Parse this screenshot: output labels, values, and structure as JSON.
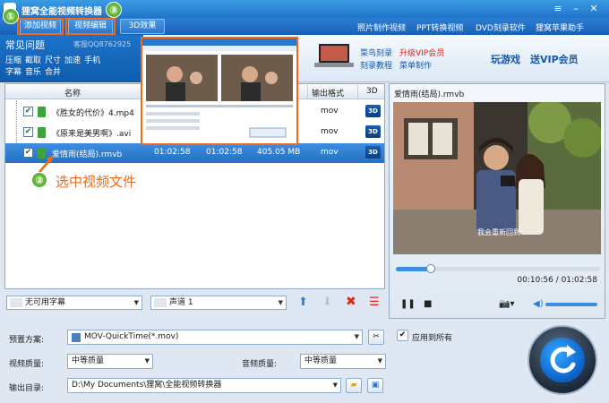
{
  "app": {
    "title": "狸窝全能视频转换器"
  },
  "toolbar": {
    "add_video": "添加视频",
    "edit_video": "视频编辑",
    "effect_3d": "3D效果",
    "links": [
      "照片制作视频",
      "PPT转换视频",
      "DVD刻录软件",
      "狸窝苹果助手"
    ]
  },
  "info": {
    "faq_title": "常见问题",
    "support_id": "客服QQ8762925",
    "faq_row1": [
      "压缩",
      "截取",
      "尺寸",
      "加速",
      "手机"
    ],
    "faq_row2": [
      "字幕",
      "音乐",
      "合并"
    ],
    "promo_1": "菜鸟刻录",
    "promo_vip": "升级VIP会员",
    "promo_2": "刻录教程",
    "promo_3": "菜单制作",
    "game_link": "玩游戏",
    "vip_link": "送VIP会员"
  },
  "file_list": {
    "headers": {
      "name": "名称",
      "output_format": "输出格式",
      "col_3d": "3D"
    },
    "rows": [
      {
        "name": "《胜女的代价》4.mp4",
        "format": "mov",
        "duration": "",
        "end": "",
        "size": ""
      },
      {
        "name": "《原来是美男啊》.avi",
        "format": "mov",
        "duration": "",
        "end": "",
        "size": ""
      },
      {
        "name": "爱情雨(结局).rmvb",
        "format": "mov",
        "duration": "01:02:58",
        "end": "01:02:58",
        "size": "405.05 MB"
      }
    ],
    "badge": "3D"
  },
  "annotations": {
    "n1": "①",
    "n2": "②",
    "n3": "③",
    "select_text": "选中视频文件"
  },
  "preview": {
    "title": "爱情雨(结局).rmvb",
    "subtitle": "我会重新回到",
    "time": "00:10:56 / 01:02:58",
    "progress": 0.17
  },
  "list_controls": {
    "subtitle_select": "无可用字幕",
    "audio_select": "声道 1"
  },
  "settings": {
    "preset_label": "预置方案:",
    "preset_value": "MOV-QuickTime(*.mov)",
    "apply_all": "应用到所有",
    "video_quality_label": "视频质量:",
    "video_quality": "中等质量",
    "audio_quality_label": "音频质量:",
    "audio_quality": "中等质量",
    "output_label": "输出目录:",
    "output_path": "D:\\My Documents\\狸窝\\全能视频转换器"
  }
}
